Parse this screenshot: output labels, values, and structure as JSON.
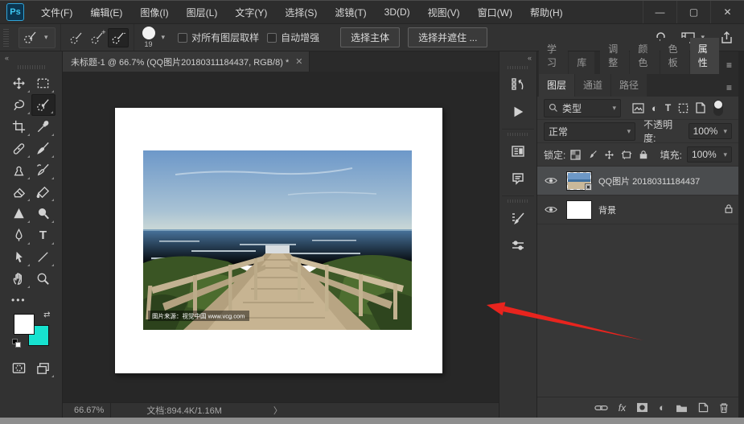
{
  "titlebar": {
    "logo": "Ps",
    "menus": [
      "文件(F)",
      "编辑(E)",
      "图像(I)",
      "图层(L)",
      "文字(Y)",
      "选择(S)",
      "滤镜(T)",
      "3D(D)",
      "视图(V)",
      "窗口(W)",
      "帮助(H)"
    ],
    "window_controls": {
      "minimize": "—",
      "maximize": "▢",
      "close": "✕"
    }
  },
  "options_bar": {
    "tool_icons": [
      "quick-selection-preset-icon",
      "new-selection-icon",
      "add-to-selection-icon",
      "subtract-from-selection-icon"
    ],
    "brush_size": "19",
    "sample_all_layers_label": "对所有图层取样",
    "auto_enhance_label": "自动增强",
    "select_subject_label": "选择主体",
    "select_and_mask_label": "选择并遮住 ...",
    "right_icons": [
      "search-icon",
      "workspace-icon",
      "share-icon"
    ]
  },
  "toolbar": {
    "tools": [
      "move",
      "marquee",
      "lasso",
      "quick-selection",
      "crop",
      "eyedropper",
      "healing-brush",
      "brush",
      "clone-stamp",
      "history-brush",
      "eraser",
      "gradient",
      "blur",
      "dodge",
      "pen",
      "type",
      "path-select",
      "line",
      "hand",
      "zoom"
    ],
    "active_tool": "quick-selection",
    "more_dots": "•••",
    "swap_glyph": "⇄",
    "foreground_color": "#ffffff",
    "background_color": "#17e2cf"
  },
  "document": {
    "tab_title": "未标题-1 @ 66.7% (QQ图片20180311184437, RGB/8) *",
    "tab_close": "✕",
    "watermark": "图片来源：视觉中国 www.vcg.com"
  },
  "dock_strip": {
    "collapse": "«",
    "icons": [
      "history-panel-icon",
      "actions-panel-icon",
      "info-panel-icon",
      "notes-panel-icon",
      "brush-settings-panel-icon",
      "brushes-panel-icon"
    ]
  },
  "panels": {
    "collapse": "»",
    "menu_glyph": "≡",
    "tabs_row1": [
      "学习",
      "库",
      "调整",
      "颜色",
      "色板",
      "属性"
    ],
    "tabs_row1_active": "属性",
    "tabs_row2": [
      "图层",
      "通道",
      "路径"
    ],
    "tabs_row2_active": "图层",
    "layers_panel": {
      "filter_label": "类型",
      "blend_mode": "正常",
      "opacity_label": "不透明度:",
      "opacity_value": "100%",
      "lock_label": "锁定:",
      "fill_label": "填充:",
      "fill_value": "100%",
      "layers": [
        {
          "name": "QQ图片 20180311184437",
          "selected": true,
          "visible": true
        },
        {
          "name": "背景",
          "selected": false,
          "visible": true,
          "locked": true
        }
      ],
      "footer_icons": [
        "link-icon",
        "fx-icon",
        "layer-mask-icon",
        "adjustment-icon",
        "group-icon",
        "new-layer-icon",
        "delete-icon"
      ],
      "fx_label": "fx"
    }
  },
  "status_bar": {
    "zoom_level": "66.67%",
    "document_size": "文档:894.4K/1.16M",
    "expand_chevron": "〉"
  },
  "colors": {
    "annotation_arrow": "#e8241e",
    "background_swatch": "#17e2cf",
    "logo_blue": "#3ec7f2",
    "selected_layer_bg": "#4a4c4e"
  }
}
